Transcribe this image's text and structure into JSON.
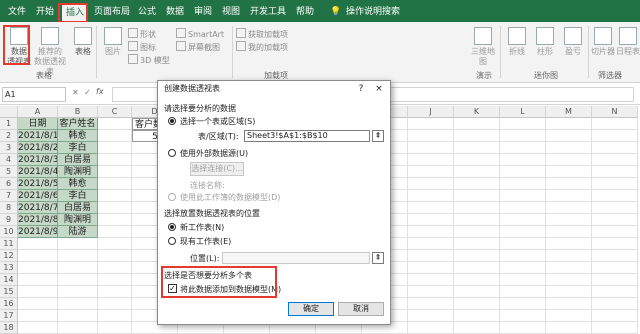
{
  "tabs": [
    "文件",
    "开始",
    "插入",
    "页面布局",
    "公式",
    "数据",
    "审阅",
    "视图",
    "开发工具",
    "帮助",
    "操作说明搜索"
  ],
  "ribbon": {
    "buttons": [
      {
        "label1": "数据",
        "label2": "透视表"
      },
      {
        "label1": "推荐的",
        "label2": "数据透视表"
      },
      {
        "label1": "表格",
        "label2": ""
      },
      {
        "label1": "图片",
        "label2": ""
      },
      {
        "label1": "SmartArt",
        "label2": ""
      },
      {
        "label1": "屏幕截图",
        "label2": ""
      },
      {
        "label1": "获取加载项",
        "label2": ""
      },
      {
        "label1": "我的加载项",
        "label2": ""
      },
      {
        "label1": "三维地",
        "label2": "图"
      },
      {
        "label1": "折线",
        "label2": ""
      },
      {
        "label1": "柱形",
        "label2": ""
      },
      {
        "label1": "盈亏",
        "label2": ""
      },
      {
        "label1": "切片器",
        "label2": ""
      },
      {
        "label1": "日程表",
        "label2": ""
      }
    ],
    "small_items": [
      "形状",
      "图标",
      "3D 模型"
    ],
    "groups": [
      "表格",
      "加载项",
      "演示",
      "迷你图",
      "筛选器"
    ]
  },
  "formula_bar": {
    "name_box": "A1",
    "fx": "fx"
  },
  "sheet": {
    "columns": [
      "A",
      "B",
      "C",
      "D",
      "E",
      "F",
      "G",
      "H",
      "I",
      "J",
      "K",
      "L",
      "M",
      "N"
    ],
    "rows": [
      "1",
      "2",
      "3",
      "4",
      "5",
      "6",
      "7",
      "8",
      "9",
      "10",
      "11",
      "12",
      "13",
      "14",
      "15",
      "16",
      "17",
      "18"
    ],
    "data": [
      [
        "日期",
        "客户姓名"
      ],
      [
        "2021/8/1",
        "韩愈"
      ],
      [
        "2021/8/2",
        "李白"
      ],
      [
        "2021/8/3",
        "白居易"
      ],
      [
        "2021/8/4",
        "陶渊明"
      ],
      [
        "2021/8/5",
        "韩愈"
      ],
      [
        "2021/8/6",
        "李白"
      ],
      [
        "2021/8/7",
        "白居易"
      ],
      [
        "2021/8/8",
        "陶渊明"
      ],
      [
        "2021/8/9",
        "陆游"
      ]
    ],
    "d1": "客户数",
    "d2": "5"
  },
  "dialog": {
    "title": "创建数据透视表",
    "help": "?",
    "close": "×",
    "section1": "请选择要分析的数据",
    "opt_select_table": "选择一个表或区域(S)",
    "range_label": "表/区域(T):",
    "range_value": "Sheet3!$A$1:$B$10",
    "opt_external": "使用外部数据源(U)",
    "choose_conn": "选择连接(C)...",
    "conn_name": "连接名称:",
    "opt_model": "使用此工作簿的数据模型(D)",
    "section2": "选择放置数据透视表的位置",
    "opt_new_sheet": "新工作表(N)",
    "opt_existing_sheet": "现有工作表(E)",
    "location_label": "位置(L):",
    "location_value": "",
    "section3": "选择是否想要分析多个表",
    "add_model": "将此数据添加到数据模型(M)",
    "ok": "确定",
    "cancel": "取消"
  }
}
